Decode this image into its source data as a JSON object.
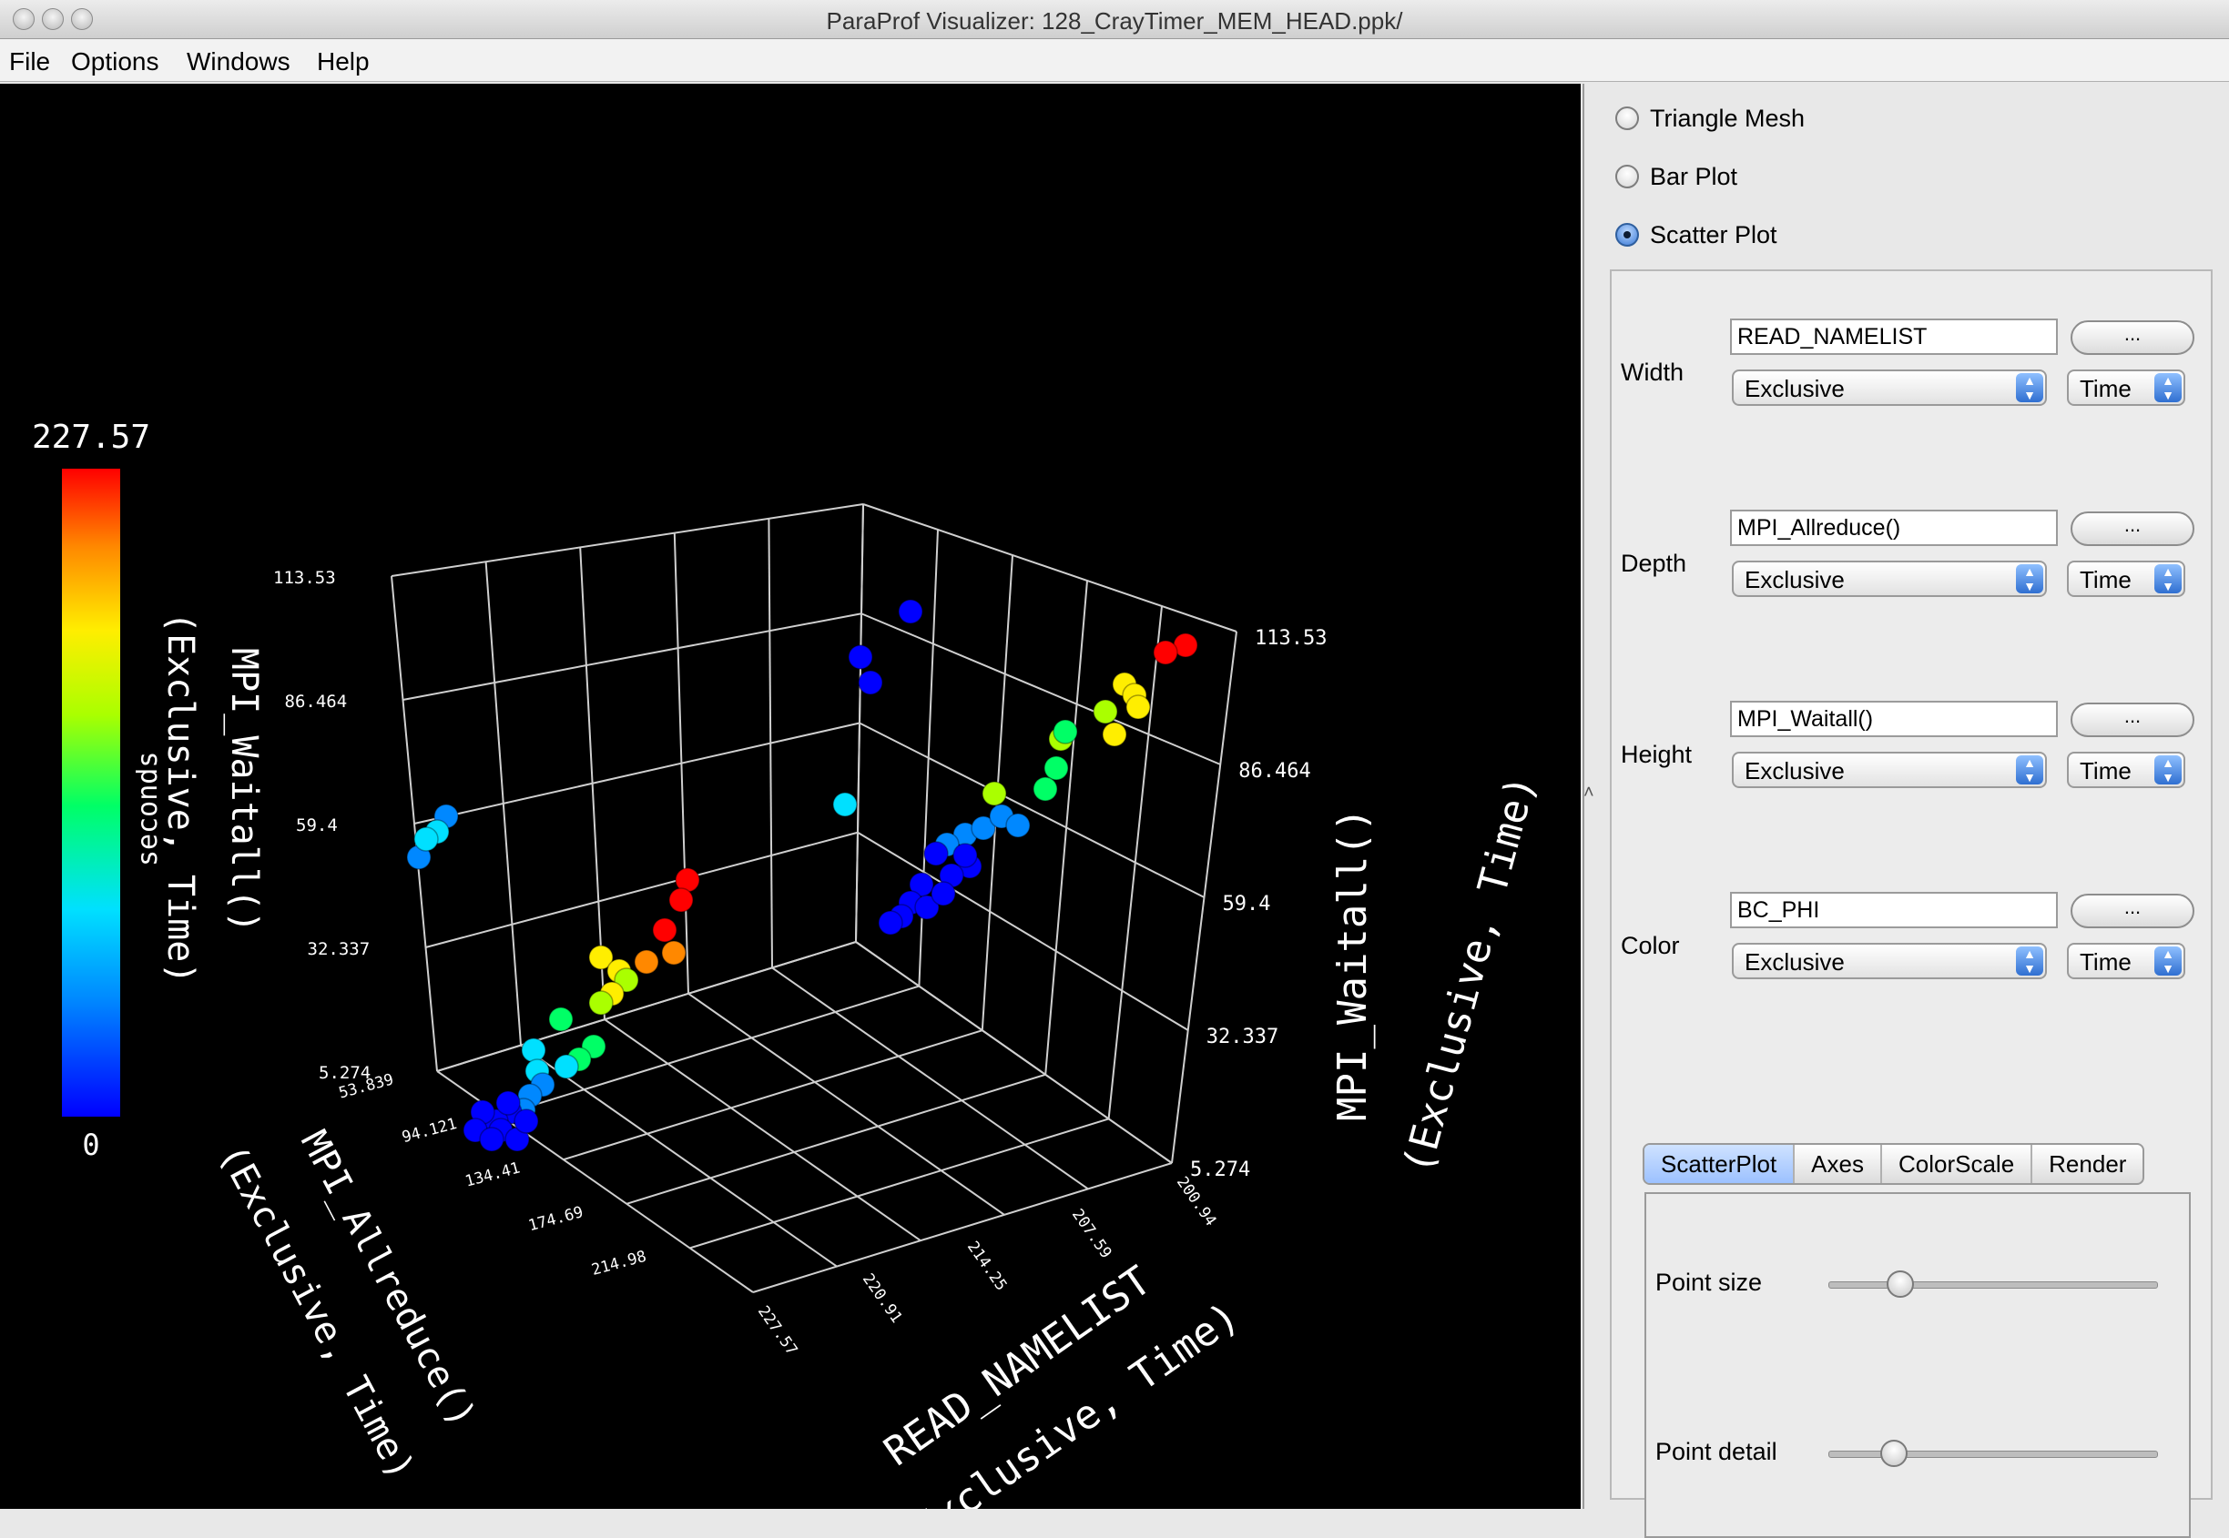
{
  "window": {
    "title": "ParaProf Visualizer: 128_CrayTimer_MEM_HEAD.ppk/"
  },
  "menu": [
    "File",
    "Options",
    "Windows",
    "Help"
  ],
  "plot_types": [
    {
      "label": "Triangle Mesh",
      "selected": false
    },
    {
      "label": "Bar Plot",
      "selected": false
    },
    {
      "label": "Scatter Plot",
      "selected": true
    }
  ],
  "axes_config": [
    {
      "label": "Width",
      "function": "READ_NAMELIST",
      "button": "...",
      "metric": "Exclusive",
      "unit": "Time"
    },
    {
      "label": "Depth",
      "function": "MPI_Allreduce()",
      "button": "...",
      "metric": "Exclusive",
      "unit": "Time"
    },
    {
      "label": "Height",
      "function": "MPI_Waitall()",
      "button": "...",
      "metric": "Exclusive",
      "unit": "Time"
    },
    {
      "label": "Color",
      "function": "BC_PHI",
      "button": "...",
      "metric": "Exclusive",
      "unit": "Time"
    }
  ],
  "tabs": [
    "ScatterPlot",
    "Axes",
    "ColorScale",
    "Render"
  ],
  "active_tab": "ScatterPlot",
  "sliders": [
    {
      "label": "Point size",
      "value": 0.22
    },
    {
      "label": "Point detail",
      "value": 0.2
    }
  ],
  "colorscale": {
    "max_label": "227.57",
    "min_label": "0",
    "unit": "seconds",
    "colors": [
      "#0000ff",
      "#0088ff",
      "#00e0ff",
      "#00ff66",
      "#aaff00",
      "#ffee00",
      "#ff8800",
      "#ff0000"
    ]
  },
  "plot_axes": {
    "height_title": "MPI_Waitall()",
    "height_sub": "(Exclusive, Time)",
    "depth_title": "MPI_Allreduce()",
    "depth_sub": "(Exclusive, Time)",
    "width_title": "READ_NAMELIST",
    "width_sub": "(Exclusive, Time)",
    "left_height_ticks": [
      "113.53",
      "86.464",
      "59.4",
      "32.337",
      "5.274"
    ],
    "right_height_ticks": [
      "113.53",
      "86.464",
      "59.4",
      "32.337",
      "5.274"
    ],
    "depth_ticks": [
      "53.839",
      "94.121",
      "134.41",
      "174.69",
      "214.98"
    ],
    "width_ticks": [
      "227.57",
      "220.91",
      "214.25",
      "207.59",
      "200.94"
    ],
    "colorbar_axis_label": "(Exclusive, Time)"
  }
}
